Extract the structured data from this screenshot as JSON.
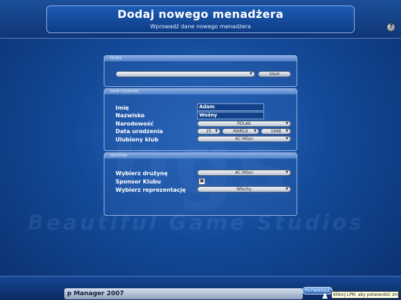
{
  "header": {
    "title": "Dodaj nowego menadżera",
    "subtitle": "Wprowadź dane nowego menadżera",
    "help_glyph": "?"
  },
  "watermark": {
    "logo": "bgs",
    "text": "Beautiful Game Studios"
  },
  "profile_panel": {
    "header": "PROFIL",
    "profile_select_value": "",
    "delete_label": "Usuń"
  },
  "personal_panel": {
    "header": "DANE OSOBOWE",
    "first_name_label": "Imię",
    "first_name_value": "Adam",
    "last_name_label": "Nazwisko",
    "last_name_value": "Woźny",
    "nationality_label": "Narodowość",
    "nationality_value": "POLAK",
    "birth_date_label": "Data urodzenia",
    "birth_day": "25",
    "birth_month": "MARCA",
    "birth_year": "1968",
    "favorite_club_label": "Ulubiony klub",
    "favorite_club_value": "AC Milan"
  },
  "team_panel": {
    "header": "DRUŻYNA",
    "choose_team_label": "Wybierz drużynę",
    "choose_team_value": "AC Milan",
    "sponsor_label": "Sponsor Klubu",
    "sponsor_checked_glyph": "✖",
    "choose_national_label": "Wybierz reprezentację",
    "choose_national_value": "Włochy"
  },
  "footer": {
    "game_name": "p Manager 2007",
    "confirm_label": "POTWIERDŹ",
    "tooltip": "Kliknij LPM, aby potwierdzić zmiany"
  },
  "icons": {
    "dropdown_arrow": "▼"
  }
}
